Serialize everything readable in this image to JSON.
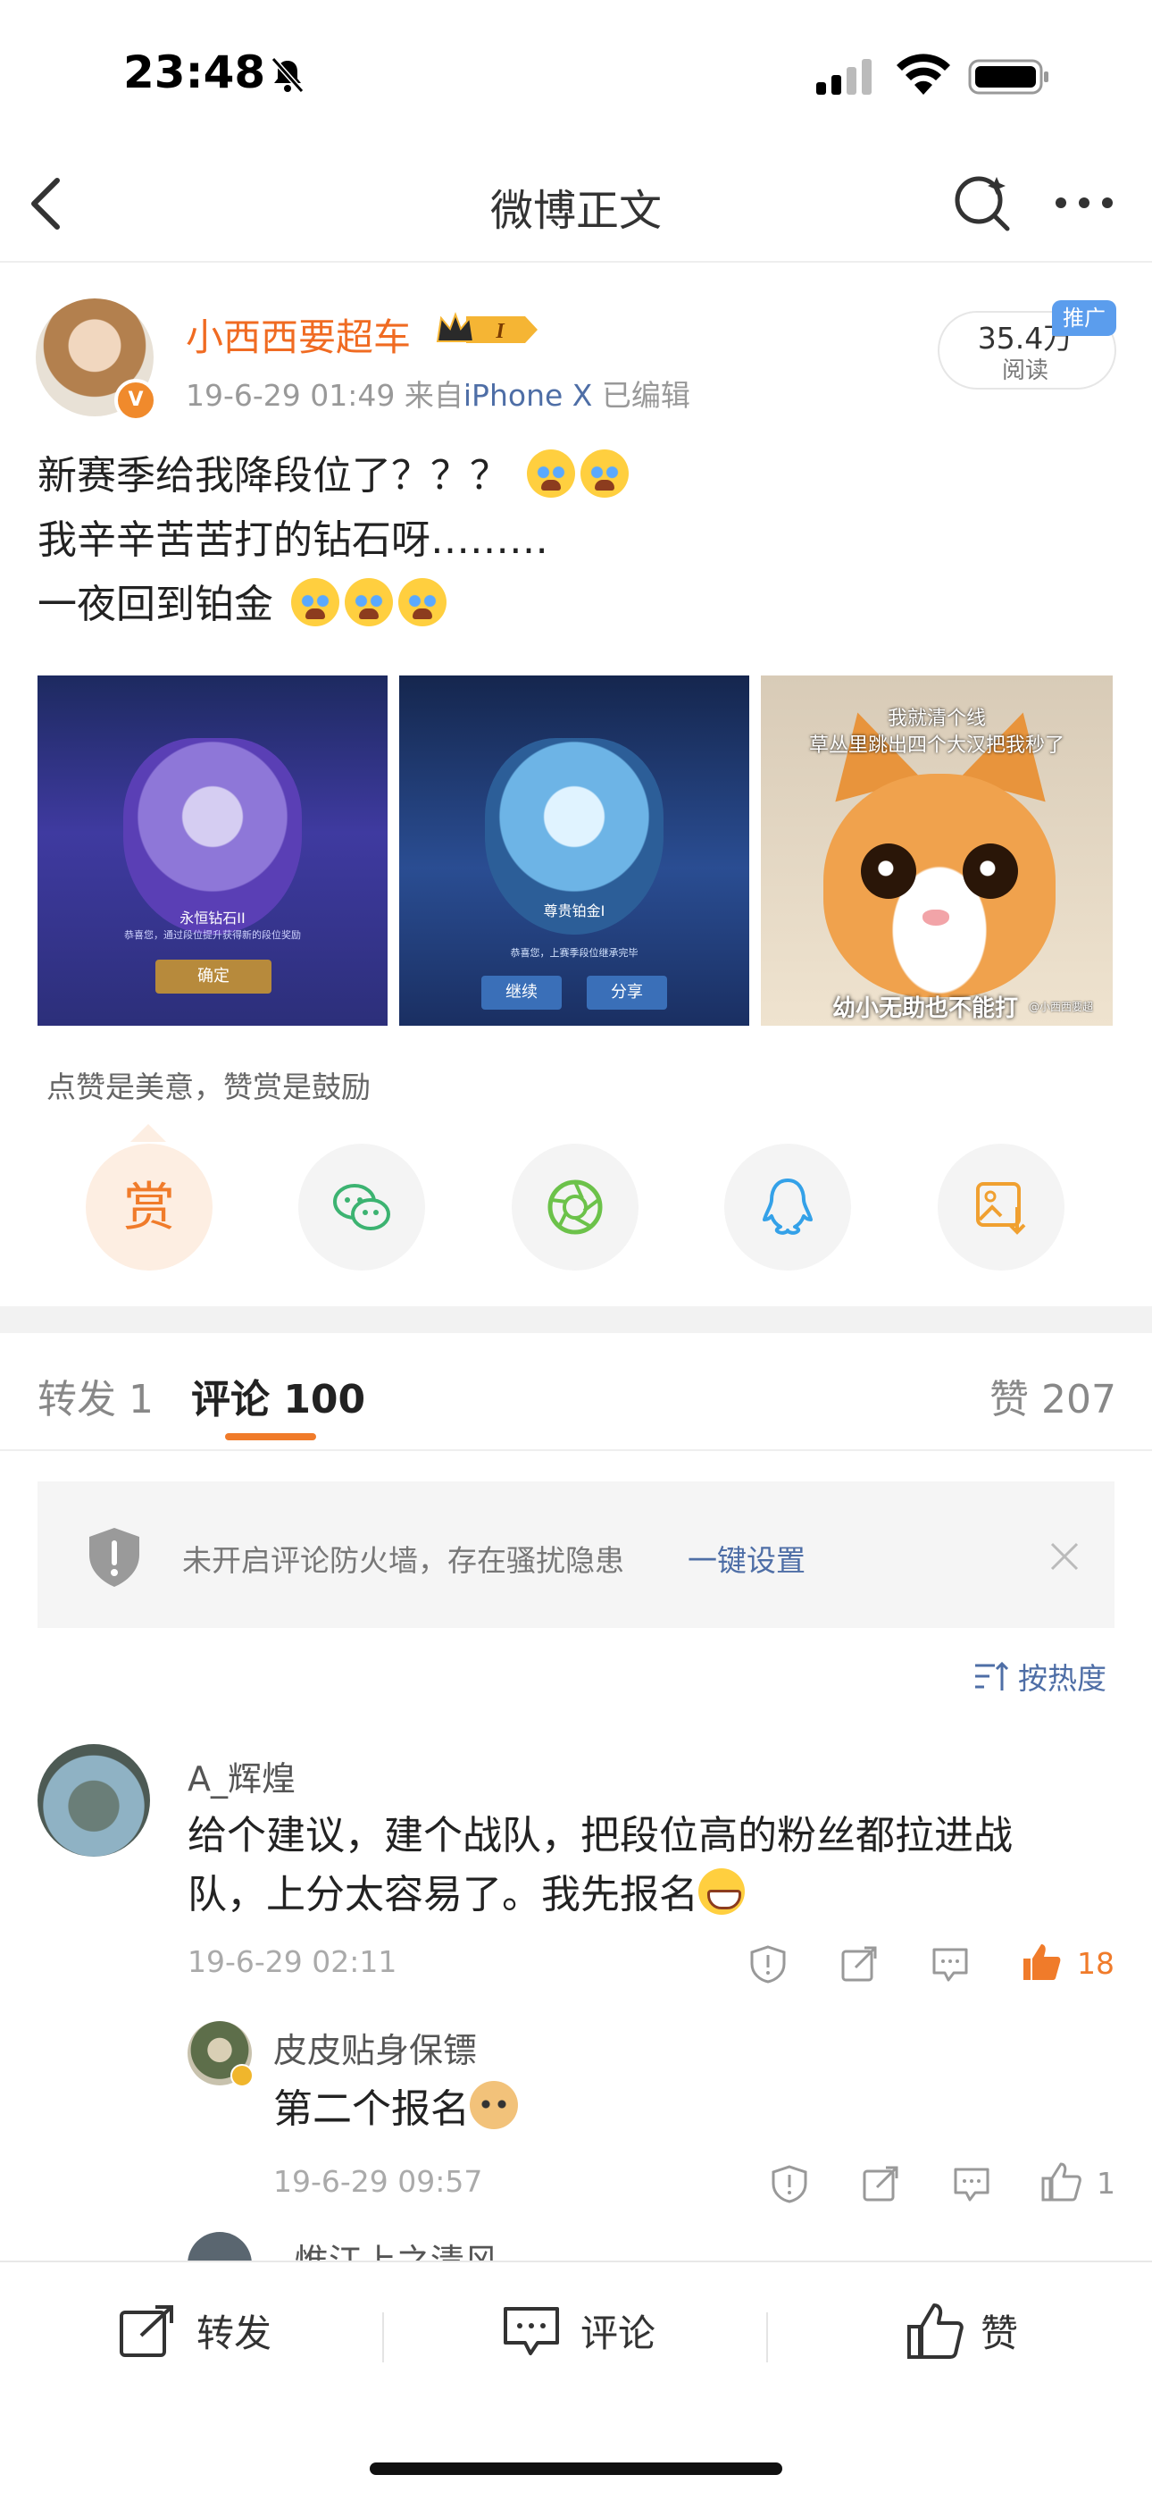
{
  "status_bar": {
    "time": "23:48"
  },
  "nav": {
    "title": "微博正文"
  },
  "post": {
    "username": "小西西要超车",
    "vip_level": "I",
    "date": "19-6-29 01:49",
    "source_prefix": "来自",
    "source": "iPhone X",
    "edited": "已编辑",
    "reads_count": "35.4万",
    "reads_label": "阅读",
    "promo_tag": "推广",
    "text_lines": [
      "新赛季给我降段位了？？？",
      "我辛辛苦苦打的钻石呀………",
      "一夜回到铂金"
    ],
    "images": [
      {
        "caption": "永恒钻石II",
        "sub": "恭喜您，通过段位提升获得新的段位奖励",
        "button": "确定"
      },
      {
        "caption": "尊贵铂金I",
        "sub": "恭喜您，上赛季段位继承完毕",
        "buttons": [
          "继续",
          "分享"
        ]
      },
      {
        "top_line1": "我就清个线",
        "top_line2": "草丛里跳出四个大汉把我秒了",
        "bottom": "幼小无助也不能打",
        "watermark": "@小西西要超"
      }
    ]
  },
  "reward": {
    "hint": "点赞是美意，赞赏是鼓励",
    "reward_label": "赏"
  },
  "tabs": {
    "repost": "转发 1",
    "comment": "评论 100",
    "like": "赞 207"
  },
  "firewall": {
    "text": "未开启评论防火墙，存在骚扰隐患",
    "link": "一键设置"
  },
  "sort": {
    "label": "按热度"
  },
  "comments": [
    {
      "name": "A_辉煌",
      "text_line1": "给个建议，建个战队，把段位高的粉丝都拉进战",
      "text_line2": "队，上分太容易了。我先报名",
      "time": "19-6-29 02:11",
      "likes": "18"
    }
  ],
  "replies": [
    {
      "name": "皮皮贴身保镖",
      "text": "第二个报名",
      "time": "19-6-29 09:57",
      "likes": "1"
    },
    {
      "name": "惟江上之清风"
    }
  ],
  "bottom_bar": {
    "repost": "转发",
    "comment": "评论",
    "like": "赞"
  },
  "colors": {
    "accent_orange": "#f07b2a",
    "link_blue": "#4e6ea6",
    "username_orange": "#f06b22"
  }
}
